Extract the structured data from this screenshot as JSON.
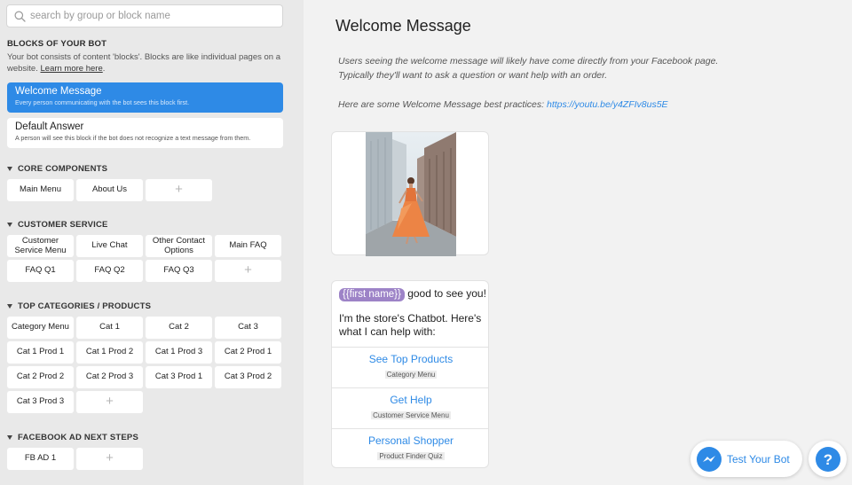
{
  "colors": {
    "accent": "#2e8ae6",
    "sidebar_bg": "#e9e9e9",
    "main_bg": "#f2f2f2",
    "variable_tag": "#9d83c7"
  },
  "search": {
    "placeholder": "search by group or block name",
    "icon": "search-icon"
  },
  "blocks": {
    "title": "BLOCKS OF YOUR BOT",
    "desc_text": "Your bot consists of content 'blocks'. Blocks are like individual pages on a website. ",
    "learn_more": "Learn more here",
    "desc_end": "."
  },
  "cards": {
    "welcome": {
      "title": "Welcome Message",
      "desc": "Every person communicating with the bot sees this block first."
    },
    "default": {
      "title": "Default Answer",
      "desc": "A person will see this block if the bot does not recognize a text message from them."
    }
  },
  "sections": {
    "core": {
      "title": "CORE COMPONENTS",
      "items": [
        "Main Menu",
        "About Us",
        "+"
      ]
    },
    "customer": {
      "title": "CUSTOMER SERVICE",
      "items": [
        "Customer Service Menu",
        "Live Chat",
        "Other Contact Options",
        "Main FAQ",
        "FAQ Q1",
        "FAQ Q2",
        "FAQ Q3",
        "+"
      ]
    },
    "categories": {
      "title": "TOP CATEGORIES / PRODUCTS",
      "items": [
        "Category Menu",
        "Cat 1",
        "Cat 2",
        "Cat 3",
        "Cat 1 Prod 1",
        "Cat 1 Prod 2",
        "Cat 1 Prod 3",
        "Cat 2 Prod 1",
        "Cat 2 Prod 2",
        "Cat 2 Prod 3",
        "Cat 3 Prod 1",
        "Cat 3 Prod 2",
        "Cat 3 Prod 3",
        "+"
      ]
    },
    "facebook": {
      "title": "FACEBOOK AD NEXT STEPS",
      "items": [
        "FB AD 1",
        "+"
      ]
    }
  },
  "main": {
    "title": "Welcome Message",
    "intro_line1": "Users seeing the welcome message will likely have come directly from your Facebook page.",
    "intro_line2": "Typically they'll want to ask a question or want help with an order.",
    "practices_text": "Here are some Welcome Message best practices: ",
    "practices_link": "https://youtu.be/y4ZFIv8us5E",
    "greeting_var": "{{first name}}",
    "greeting_rest": " good to see you!",
    "bot_intro": "I'm the store's Chatbot.  Here's what I can help with:",
    "quick_replies": [
      {
        "label": "See Top Products",
        "sub": "Category Menu"
      },
      {
        "label": "Get Help",
        "sub": "Customer Service Menu"
      },
      {
        "label": "Personal Shopper",
        "sub": "Product Finder Quiz"
      }
    ]
  },
  "widgets": {
    "test_bot": "Test Your Bot",
    "help": "?"
  }
}
